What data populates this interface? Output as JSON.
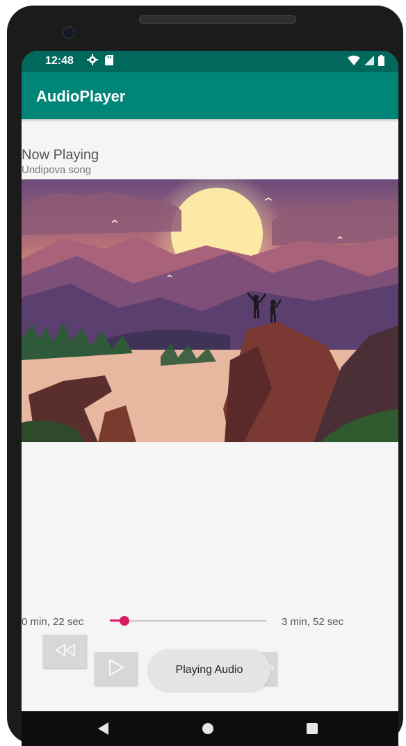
{
  "status_bar": {
    "time": "12:48",
    "icons": [
      "settings-gear-icon",
      "sd-card-icon",
      "wifi-icon",
      "cell-signal-icon",
      "battery-icon"
    ]
  },
  "app_bar": {
    "title": "AudioPlayer",
    "color": "#008577"
  },
  "now_playing": {
    "label": "Now Playing",
    "song": "Undipova song"
  },
  "album_art": {
    "description_icon": "album-artwork-image"
  },
  "player": {
    "elapsed": "0 min, 22 sec",
    "total": "3 min, 52 sec",
    "progress": 0.095,
    "accent": "#d81b60"
  },
  "controls": {
    "rewind_icon": "rewind-icon",
    "play_icon": "play-icon",
    "forward_icon": "fast-forward-icon"
  },
  "toast": {
    "message": "Playing Audio"
  },
  "nav_bar": {
    "icons": [
      "back-icon",
      "home-icon",
      "recents-icon"
    ]
  }
}
